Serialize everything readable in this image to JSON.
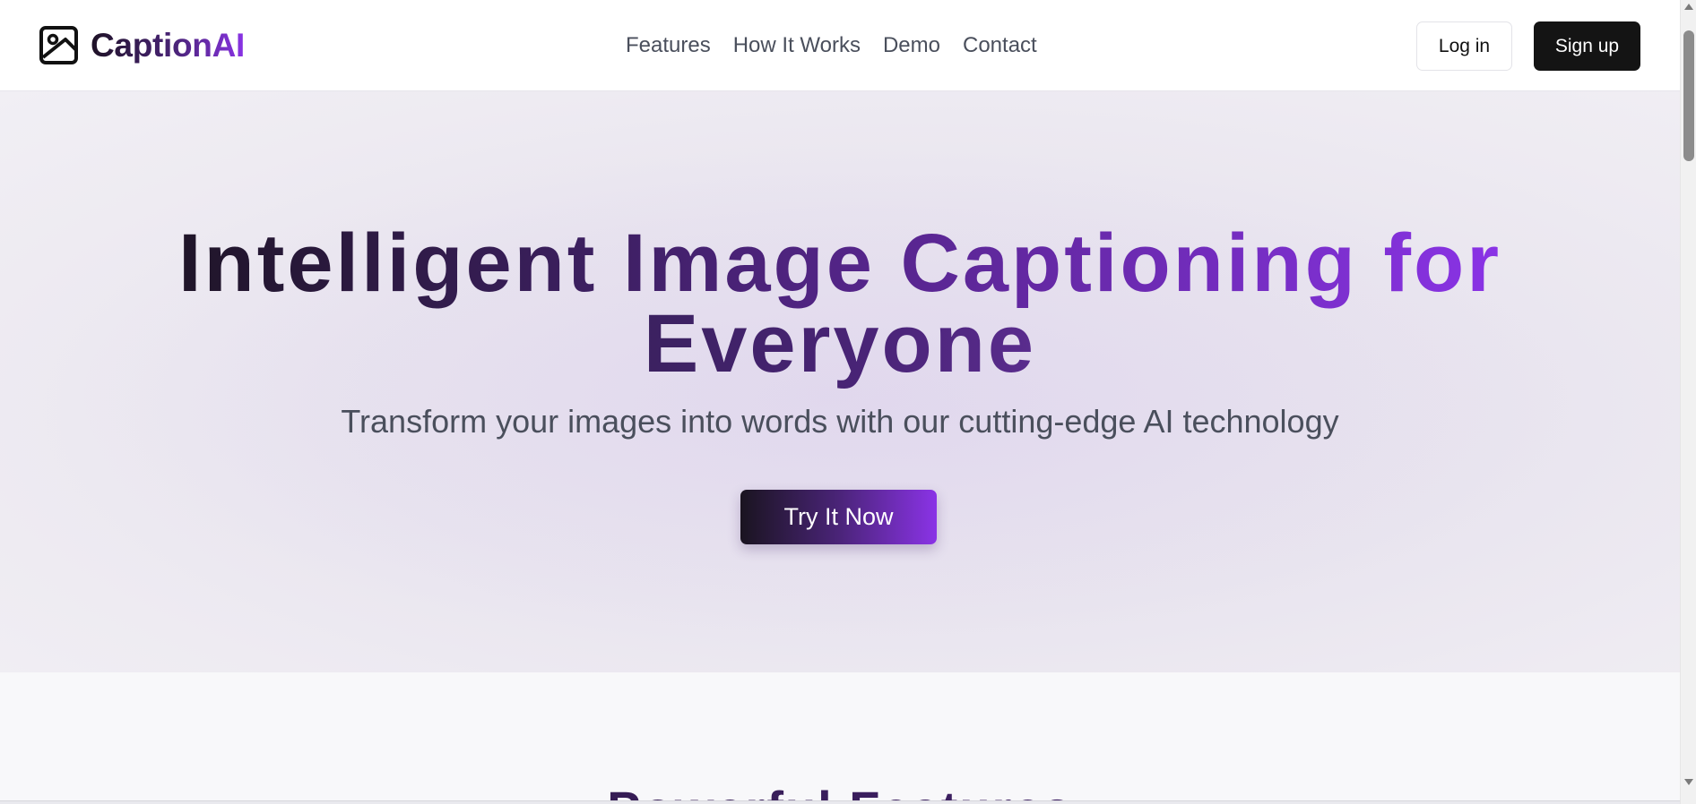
{
  "header": {
    "brand": "CaptionAI",
    "brand_icon": "image-icon",
    "nav": [
      {
        "label": "Features"
      },
      {
        "label": "How It Works"
      },
      {
        "label": "Demo"
      },
      {
        "label": "Contact"
      }
    ],
    "login_label": "Log in",
    "signup_label": "Sign up"
  },
  "hero": {
    "title_line1": "Intelligent Image Captioning for",
    "title_line2": "Everyone",
    "subtitle": "Transform your images into words with our cutting-edge AI technology",
    "cta_label": "Try It Now"
  },
  "features": {
    "heading": "Powerful Features"
  },
  "colors": {
    "accent": "#8a33e6",
    "dark": "#1a1420",
    "primary_button": "#141414",
    "text_muted": "#4a4f5c"
  }
}
